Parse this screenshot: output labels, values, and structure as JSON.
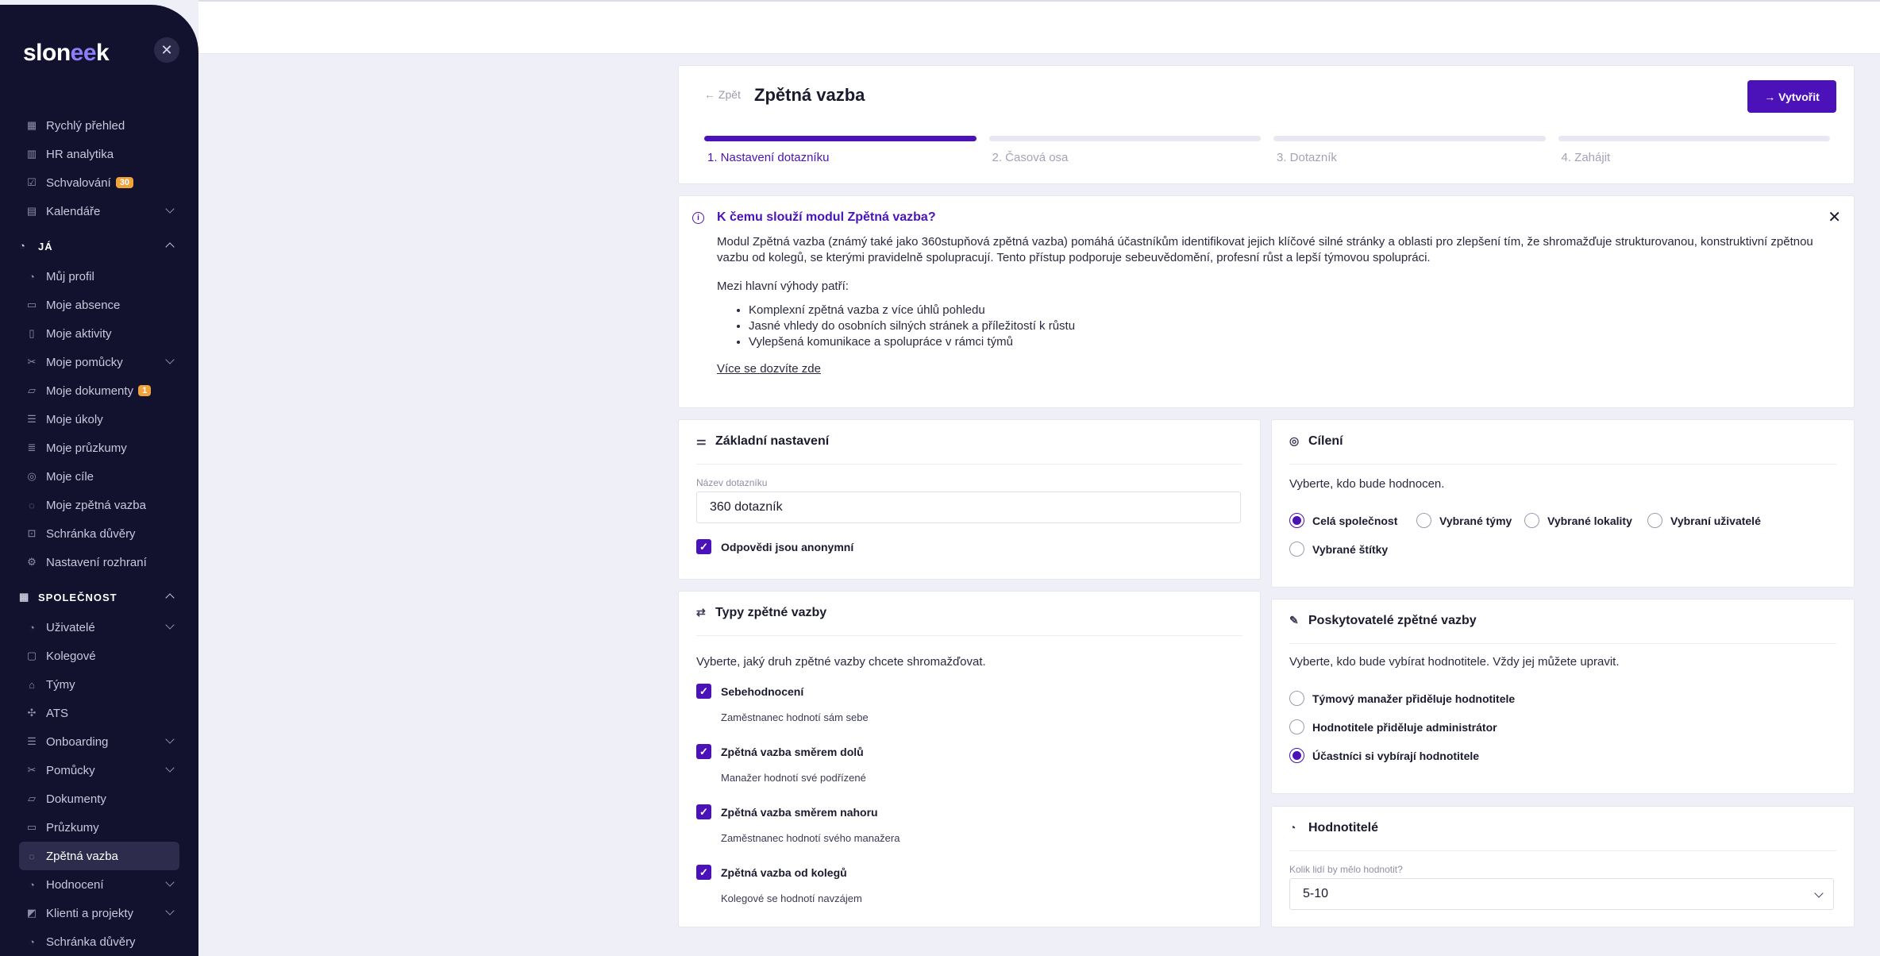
{
  "sidebar": {
    "logo": "slon",
    "logo_mark": "ee",
    "logo_end": "k",
    "close_glyph": "✕",
    "top_items": [
      {
        "label": "Rychlý přehled",
        "icon": "table-icon",
        "glyph": "▦"
      },
      {
        "label": "HR analytika",
        "icon": "chart-icon",
        "glyph": "▥"
      },
      {
        "label": "Schvalování",
        "icon": "checklist-icon",
        "glyph": "☑",
        "badge": "30"
      },
      {
        "label": "Kalendáře",
        "icon": "calendar-icon",
        "glyph": "▤"
      }
    ],
    "me_section": "JÁ",
    "me_items": [
      {
        "label": "Můj profil",
        "icon": "user-icon",
        "glyph": "◔"
      },
      {
        "label": "Moje absence",
        "icon": "bed-icon",
        "glyph": "▭"
      },
      {
        "label": "Moje aktivity",
        "icon": "book-icon",
        "glyph": "▯"
      },
      {
        "label": "Moje pomůcky",
        "icon": "tools-icon",
        "glyph": "✂"
      },
      {
        "label": "Moje dokumenty",
        "icon": "folder-icon",
        "glyph": "▱",
        "badge": "1"
      },
      {
        "label": "Moje úkoly",
        "icon": "list-icon",
        "glyph": "☰"
      },
      {
        "label": "Moje průzkumy",
        "icon": "survey-icon",
        "glyph": "≣"
      },
      {
        "label": "Moje cíle",
        "icon": "target-icon",
        "glyph": "◎"
      },
      {
        "label": "Moje zpětná vazba",
        "icon": "chat-icon",
        "glyph": "◌"
      },
      {
        "label": "Schránka důvěry",
        "icon": "inbox-icon",
        "glyph": "⊡"
      },
      {
        "label": "Nastavení rozhraní",
        "icon": "gear-icon",
        "glyph": "⚙"
      }
    ],
    "company_section": "SPOLEČNOST",
    "company_items": [
      {
        "label": "Uživatelé",
        "icon": "users-icon",
        "glyph": "◔"
      },
      {
        "label": "Kolegové",
        "icon": "contacts-icon",
        "glyph": "▢"
      },
      {
        "label": "Týmy",
        "icon": "team-icon",
        "glyph": "⌂"
      },
      {
        "label": "ATS",
        "icon": "ats-icon",
        "glyph": "✣"
      },
      {
        "label": "Onboarding",
        "icon": "onboarding-icon",
        "glyph": "☰"
      },
      {
        "label": "Pomůcky",
        "icon": "tools-icon",
        "glyph": "✂"
      },
      {
        "label": "Dokumenty",
        "icon": "folder-icon",
        "glyph": "▱"
      },
      {
        "label": "Průzkumy",
        "icon": "survey-icon",
        "glyph": "▭"
      },
      {
        "label": "Zpětná vazba",
        "icon": "chat-icon",
        "glyph": "◌"
      },
      {
        "label": "Hodnocení",
        "icon": "rating-icon",
        "glyph": "◔"
      },
      {
        "label": "Klienti a projekty",
        "icon": "clients-icon",
        "glyph": "◩"
      },
      {
        "label": "Schránka důvěry",
        "icon": "inbox-icon",
        "glyph": "◔"
      }
    ]
  },
  "header": {
    "back_label": "← Zpět",
    "title": "Zpětná vazba",
    "create_label": "→ Vytvořit",
    "steps": [
      {
        "label": "1. Nastavení dotazníku",
        "done": true
      },
      {
        "label": "2. Časová osa",
        "done": false
      },
      {
        "label": "3. Dotazník",
        "done": false
      },
      {
        "label": "4. Zahájit",
        "done": false
      }
    ]
  },
  "info": {
    "title": "K čemu slouží modul Zpětná vazba?",
    "paragraph": "Modul Zpětná vazba (známý také jako 360stupňová zpětná vazba) pomáhá účastníkům identifikovat jejich klíčové silné stránky a oblasti pro zlepšení tím, že shromažďuje strukturovanou, konstruktivní zpětnou vazbu od kolegů, se kterými pravidelně spolupracují. Tento přístup podporuje sebeuvědomění, profesní růst a lepší týmovou spolupráci.",
    "benefits_intro": "Mezi hlavní výhody patří:",
    "benefits": [
      "Komplexní zpětná vazba z více úhlů pohledu",
      "Jasné vhledy do osobních silných stránek a příležitostí k růstu",
      "Vylepšená komunikace a spolupráce v rámci týmů"
    ],
    "learn_more": "Více se dozvíte zde",
    "close_glyph": "✕"
  },
  "basic": {
    "title": "Základní nastavení",
    "name_label": "Název dotazníku",
    "name_value": "360 dotazník",
    "anonymous_label": "Odpovědi jsou anonymní"
  },
  "types": {
    "title": "Typy zpětné vazby",
    "description": "Vyberte, jaký druh zpětné vazby chcete shromažďovat.",
    "options": [
      {
        "label": "Sebehodnocení",
        "desc": "Zaměstnanec hodnotí sám sebe"
      },
      {
        "label": "Zpětná vazba směrem dolů",
        "desc": "Manažer hodnotí své podřízené"
      },
      {
        "label": "Zpětná vazba směrem nahoru",
        "desc": "Zaměstnanec hodnotí svého manažera"
      },
      {
        "label": "Zpětná vazba od kolegů",
        "desc": "Kolegové se hodnotí navzájem"
      }
    ]
  },
  "targeting": {
    "title": "Cílení",
    "description": "Vyberte, kdo bude hodnocen.",
    "options": [
      {
        "label": "Celá společnost",
        "selected": true
      },
      {
        "label": "Vybrané týmy",
        "selected": false
      },
      {
        "label": "Vybrané lokality",
        "selected": false
      },
      {
        "label": "Vybraní uživatelé",
        "selected": false
      },
      {
        "label": "Vybrané štítky",
        "selected": false
      }
    ]
  },
  "providers": {
    "title": "Poskytovatelé zpětné vazby",
    "description": "Vyberte, kdo bude vybírat hodnotitele. Vždy jej můžete upravit.",
    "options": [
      {
        "label": "Týmový manažer přiděluje hodnotitele",
        "selected": false
      },
      {
        "label": "Hodnotitele přiděluje administrátor",
        "selected": false
      },
      {
        "label": "Účastníci si vybírají hodnotitele",
        "selected": true
      }
    ]
  },
  "raters": {
    "title": "Hodnotitelé",
    "count_label": "Kolik lidí by mělo hodnotit?",
    "count_value": "5-10"
  },
  "colors": {
    "accent": "#4a12b8",
    "sidebar_bg": "#12112e",
    "badge": "#f0a33a"
  }
}
